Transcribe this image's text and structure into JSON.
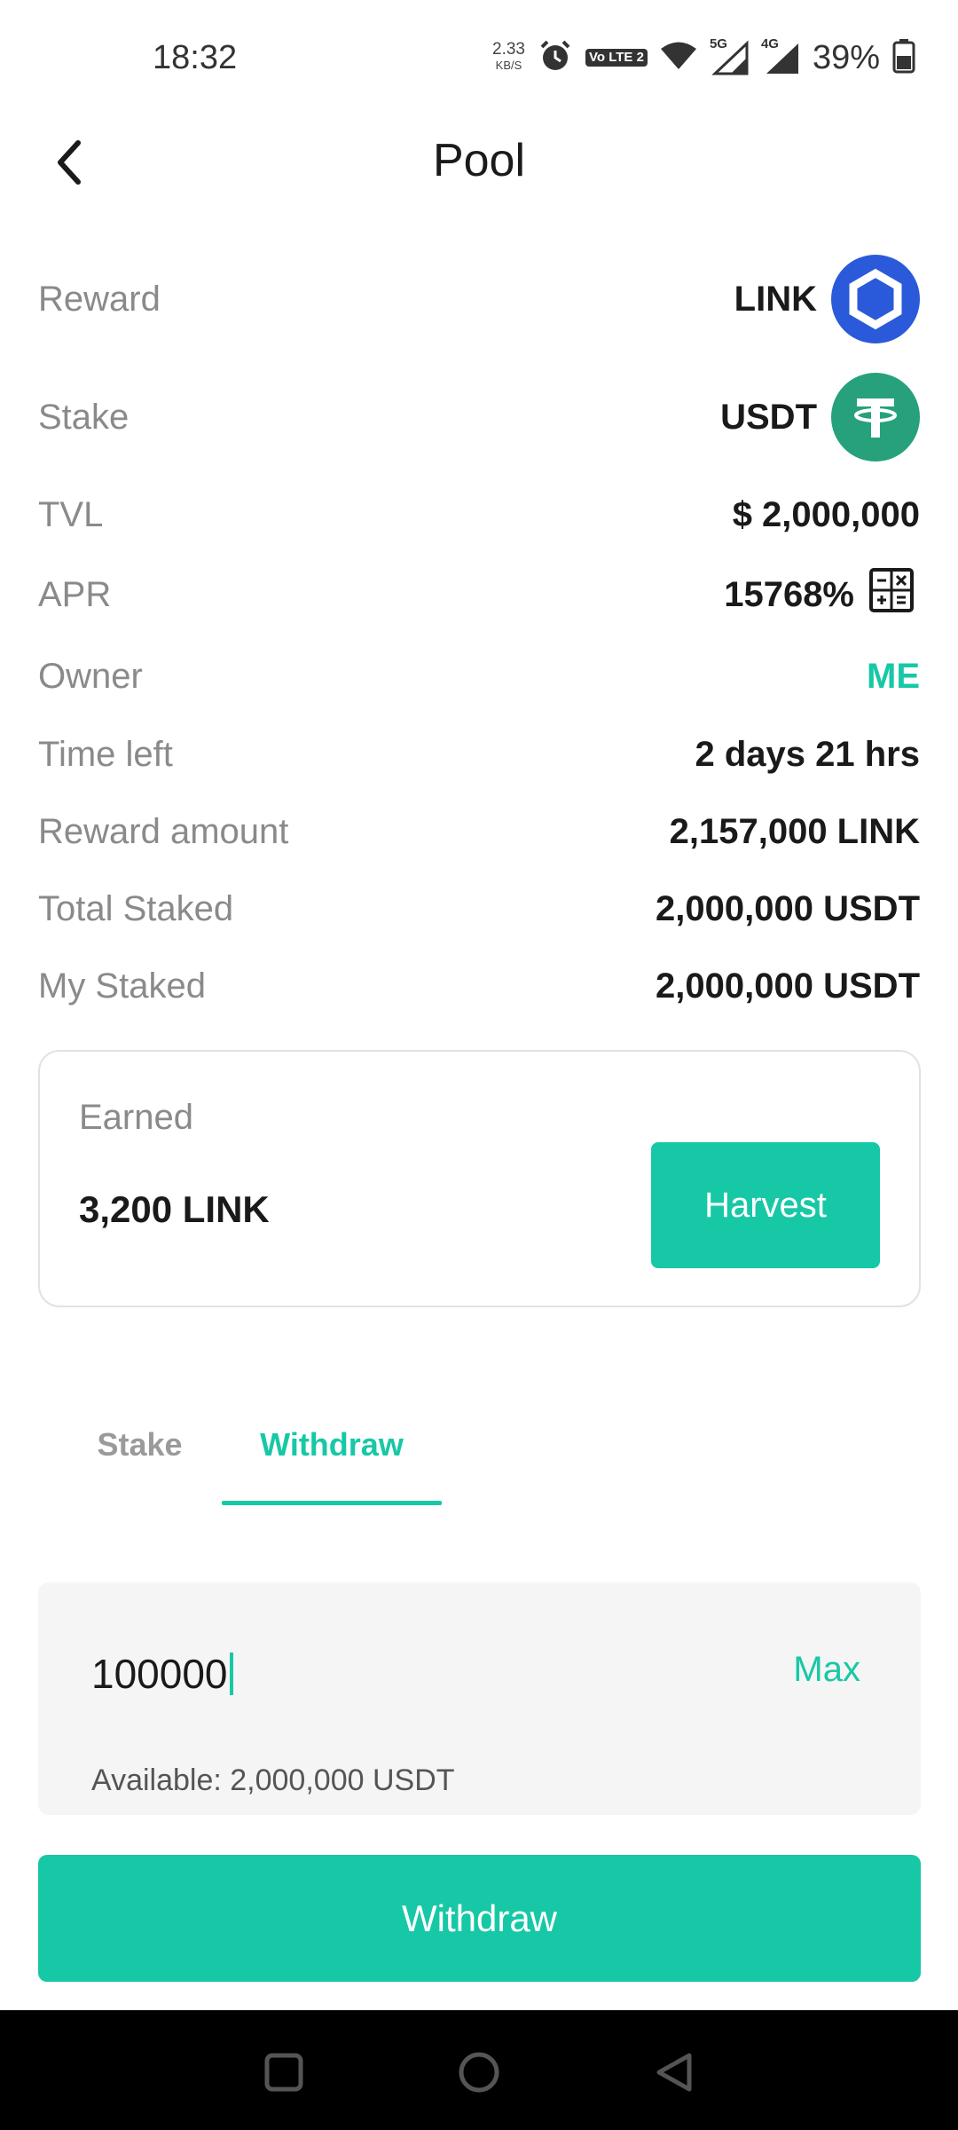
{
  "status_bar": {
    "time": "18:32",
    "net_speed": "2.33",
    "net_unit": "KB/S",
    "lte_badge": "Vo LTE 2",
    "sig1_label": "5G",
    "sig2_label": "4G",
    "battery_percent": "39%"
  },
  "header": {
    "title": "Pool",
    "back_icon": "chevron-left-icon"
  },
  "info": {
    "reward_label": "Reward",
    "reward_token": "LINK",
    "stake_label": "Stake",
    "stake_token": "USDT",
    "tvl_label": "TVL",
    "tvl_value": "$ 2,000,000",
    "apr_label": "APR",
    "apr_value": "15768%",
    "owner_label": "Owner",
    "owner_value": "ME",
    "time_left_label": "Time left",
    "time_left_value": "2 days 21 hrs",
    "reward_amount_label": "Reward amount",
    "reward_amount_value": "2,157,000 LINK",
    "total_staked_label": "Total Staked",
    "total_staked_value": "2,000,000 USDT",
    "my_staked_label": "My Staked",
    "my_staked_value": "2,000,000 USDT"
  },
  "earned": {
    "label": "Earned",
    "value": "3,200 LINK",
    "harvest_label": "Harvest"
  },
  "tabs": {
    "stake": "Stake",
    "withdraw": "Withdraw",
    "active": "Withdraw"
  },
  "amount": {
    "value": "100000",
    "max_label": "Max",
    "available": "Available: 2,000,000 USDT"
  },
  "withdraw_button": "Withdraw",
  "colors": {
    "accent": "#17c8a6",
    "link_brand": "#2a5ada",
    "usdt_brand": "#26a17b"
  }
}
